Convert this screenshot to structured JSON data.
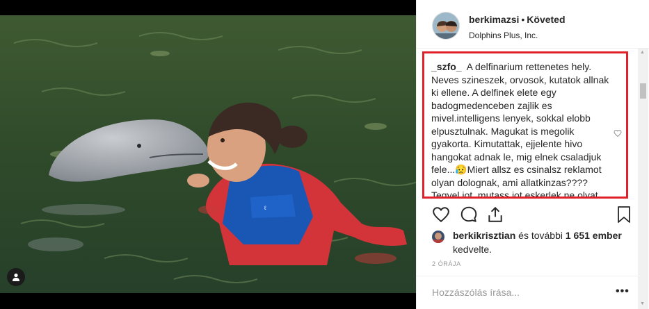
{
  "post": {
    "username": "berkimazsi",
    "separator": "•",
    "follow_status": "Követed",
    "location": "Dolphins Plus, Inc."
  },
  "comment": {
    "user": "_szfo_",
    "text": "A delfinarium rettenetes hely. Neves szineszek, orvosok, kutatok allnak ki ellene. A delfinek elete egy badogmedenceben zajlik es mivel.intelligens lenyek, sokkal elobb elpusztulnak. Magukat is megolik gyakorta. Kimutattak, ejjelente hivo hangokat adnak le, mig elnek csaladjuk fele...😥Miert allsz es csinalsz reklamot olyan dolognak, ami allatkinzas???? Tegyel jot, mutass jot eskerlek ne olyat"
  },
  "likes": {
    "first_user": "berkikrisztian",
    "middle": " és további ",
    "count": "1 651 ember",
    "line2": "kedvelte."
  },
  "timestamp": "2 ÓRÁJA",
  "add_comment": {
    "placeholder": "Hozzászólás írása...",
    "more_label": "•••"
  },
  "icons": {
    "like": "heart-icon",
    "comment": "comment-icon",
    "share": "share-icon",
    "save": "bookmark-icon",
    "tag": "user-tag-icon"
  },
  "colors": {
    "highlight_border": "#e0212a",
    "text": "#262626",
    "muted": "#999999"
  }
}
